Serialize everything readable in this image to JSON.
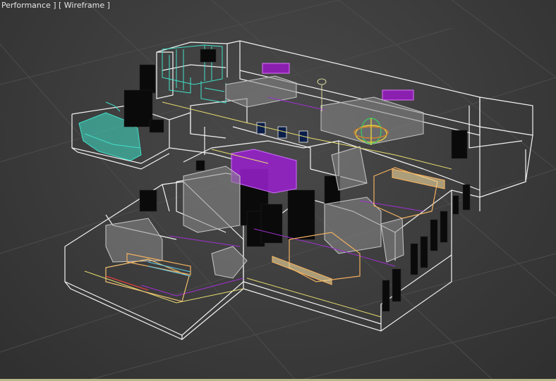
{
  "viewport": {
    "label_left": "Performance ]",
    "label_right": "[ Wireframe ]",
    "mode": "Wireframe"
  },
  "colors": {
    "background": "#3d3d3d",
    "grid": "#4e4e4e",
    "walls": "#ffffff",
    "furniture_gray": "#b4b4b4",
    "cyan_object": "#40e0c8",
    "magenta_object": "#b020d8",
    "yellow_line": "#e6dc6e",
    "orange_object": "#f0b060",
    "black_objects": "#0a0a0a",
    "purple_line": "#a030d0"
  }
}
